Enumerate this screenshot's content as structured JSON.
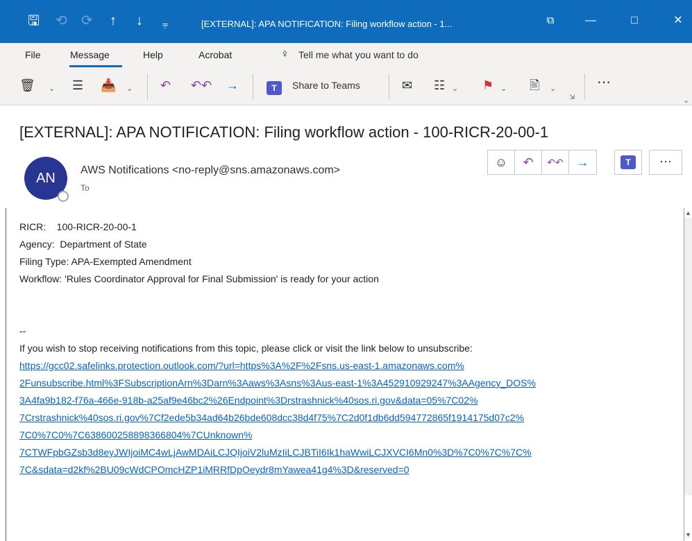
{
  "window": {
    "title": "[EXTERNAL]: APA NOTIFICATION: Filing workflow action - 1...",
    "quick_access_icons": [
      "save-icon",
      "undo-icon",
      "redo-icon",
      "up-arrow-icon",
      "down-arrow-icon",
      "customize-icon"
    ],
    "controls": [
      "restore-tab-icon",
      "minimize-icon",
      "maximize-icon",
      "close-icon"
    ]
  },
  "menu": {
    "items": [
      "File",
      "Message",
      "Help",
      "Acrobat"
    ],
    "active": "Message",
    "tell_me": "Tell me what you want to do"
  },
  "ribbon": {
    "share_to_teams": "Share to Teams"
  },
  "message": {
    "subject": "[EXTERNAL]: APA NOTIFICATION: Filing workflow action - 100-RICR-20-00-1",
    "avatar_initials": "AN",
    "sender": "AWS Notifications <no-reply@sns.amazonaws.com>",
    "to_label": "To",
    "body_lines": [
      "RICR:    100-RICR-20-00-1",
      "Agency:  Department of State",
      "Filing Type: APA-Exempted Amendment",
      "Workflow: 'Rules Coordinator Approval for Final Submission' is ready for your action"
    ],
    "separator": "--",
    "unsubscribe_text": "If you wish to stop receiving notifications from this topic, please click or visit the link below to unsubscribe:",
    "link_lines": [
      "https://gcc02.safelinks.protection.outlook.com/?url=https%3A%2F%2Fsns.us-east-1.amazonaws.com%",
      "2Funsubscribe.html%3FSubscriptionArn%3Darn%3Aaws%3Asns%3Aus-east-1%3A452910929247%3AAgency_DOS%",
      "3A4fa9b182-f76a-466e-918b-a25af9e46bc2%26Endpoint%3Drstrashnick%40sos.ri.gov&data=05%7C02%",
      "7Crstrashnick%40sos.ri.gov%7Cf2ede5b34ad64b26bde608dcc38d4f75%7C2d0f1db6dd594772865f1914175d07c2%",
      "7C0%7C0%7C638600258898366804%7CUnknown%",
      "7CTWFpbGZsb3d8eyJWIjoiMC4wLjAwMDAiLCJQIjoiV2luMzIiLCJBTiI6Ik1haWwiLCJXVCI6Mn0%3D%7C0%7C%7C%",
      "7C&sdata=d2kf%2BU09cWdCPOmcHZP1iMRRfDpOeydr8mYawea41g4%3D&reserved=0"
    ]
  },
  "colors": {
    "titlebar": "#0f6cbd",
    "avatar": "#283593",
    "link": "#0563c1",
    "teams": "#5059c9"
  }
}
